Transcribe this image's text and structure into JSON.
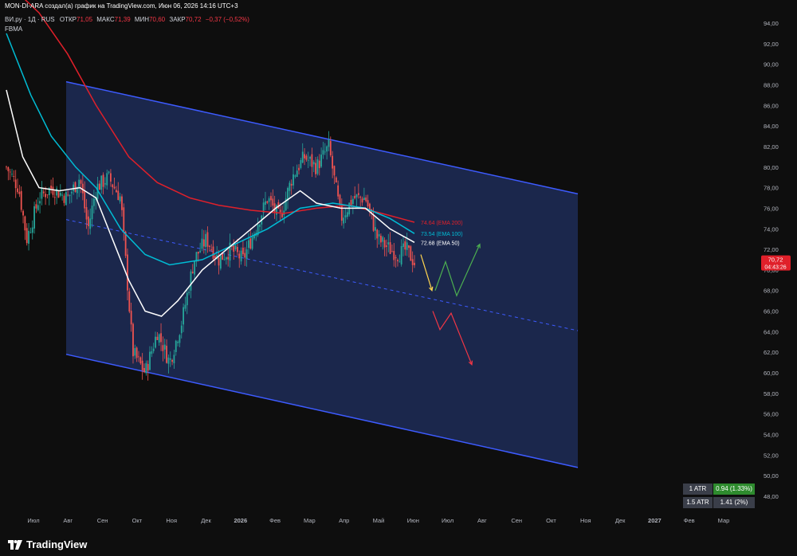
{
  "header": {
    "author_line": "MON-DI-ARA создал(а) график на TradingView.com, Июн 06, 2026 14:16 UTC+3",
    "symbol": "ВИ.ру · 1Д · RUS",
    "open_label": "ОТКР",
    "open_value": "71,05",
    "high_label": "МАКС",
    "high_value": "71,39",
    "low_label": "МИН",
    "low_value": "70,60",
    "close_label": "ЗАКР",
    "close_value": "70,72",
    "change_value": "−0,37 (−0,52%)",
    "indicator_label": "FBMA"
  },
  "price_badge": {
    "price": "70,72",
    "countdown": "04:43:26"
  },
  "atr_table": [
    {
      "label": "1 ATR",
      "value": "0.94 (1.33%)"
    },
    {
      "label": "1.5 ATR",
      "value": "1.41 (2%)"
    }
  ],
  "branding": {
    "logo_text": "TradingView"
  },
  "colors": {
    "background": "#0e0e0e",
    "channel_fill": "#1d2b57",
    "channel_line": "#3d5bff",
    "ema50": "#ffffff",
    "ema100": "#00bcd4",
    "ema200": "#e0202a",
    "up_candle": "#26a69a",
    "down_candle": "#ef5350",
    "arrow_yellow": "#ffd54f",
    "arrow_green": "#4caf50",
    "arrow_red": "#f23645",
    "atr_green": "#2e8b2e"
  },
  "chart_data": {
    "type": "line",
    "title": "",
    "xlabel": "",
    "ylabel": "",
    "y_axis_side": "right",
    "grid": false,
    "ylim": [
      47,
      95
    ],
    "y_ticks": [
      "94,00",
      "92,00",
      "90,00",
      "88,00",
      "86,00",
      "84,00",
      "82,00",
      "80,00",
      "78,00",
      "76,00",
      "74,00",
      "72,00",
      "70,00",
      "68,00",
      "66,00",
      "64,00",
      "62,00",
      "60,00",
      "58,00",
      "56,00",
      "54,00",
      "52,00",
      "50,00",
      "48,00"
    ],
    "x_ticks": [
      "Июл",
      "Авг",
      "Сен",
      "Окт",
      "Ноя",
      "Дек",
      "2026",
      "Фев",
      "Мар",
      "Апр",
      "Май",
      "Июн",
      "Июл",
      "Авг",
      "Сен",
      "Окт",
      "Ноя",
      "Дек",
      "2027",
      "Фев",
      "Мар"
    ],
    "last_price": 70.72,
    "price_path": [
      [
        0,
        80
      ],
      [
        3,
        78
      ],
      [
        5,
        73
      ],
      [
        8,
        77
      ],
      [
        11,
        78
      ],
      [
        15,
        77
      ],
      [
        18,
        79
      ],
      [
        20,
        74
      ],
      [
        22,
        78
      ],
      [
        25,
        79
      ],
      [
        28,
        77
      ],
      [
        31,
        62
      ],
      [
        34,
        60
      ],
      [
        37,
        64
      ],
      [
        40,
        61
      ],
      [
        43,
        65
      ],
      [
        46,
        71
      ],
      [
        49,
        73
      ],
      [
        52,
        71
      ],
      [
        55,
        72
      ],
      [
        58,
        71
      ],
      [
        61,
        74
      ],
      [
        64,
        77
      ],
      [
        67,
        75
      ],
      [
        70,
        79
      ],
      [
        73,
        81
      ],
      [
        76,
        80
      ],
      [
        79,
        82
      ],
      [
        82,
        75
      ],
      [
        85,
        77
      ],
      [
        88,
        77
      ],
      [
        91,
        73
      ],
      [
        94,
        72
      ],
      [
        96,
        71.5
      ],
      [
        98,
        72
      ],
      [
        100,
        70.7
      ]
    ],
    "series": [
      {
        "name": "EMA 200",
        "value": 74.64,
        "label": "74.64 (EMA 200)",
        "points": [
          [
            0,
            98
          ],
          [
            8,
            95
          ],
          [
            15,
            91
          ],
          [
            22,
            86
          ],
          [
            30,
            81
          ],
          [
            37,
            78.5
          ],
          [
            45,
            77
          ],
          [
            52,
            76.3
          ],
          [
            60,
            75.8
          ],
          [
            68,
            75.5
          ],
          [
            76,
            76
          ],
          [
            84,
            76.3
          ],
          [
            92,
            75.5
          ],
          [
            100,
            74.64
          ]
        ]
      },
      {
        "name": "EMA 100",
        "value": 73.54,
        "label": "73.54 (EMA 100)",
        "points": [
          [
            0,
            93
          ],
          [
            6,
            87
          ],
          [
            11,
            83
          ],
          [
            17,
            80
          ],
          [
            22,
            78
          ],
          [
            28,
            74
          ],
          [
            34,
            71.5
          ],
          [
            40,
            70.5
          ],
          [
            48,
            71
          ],
          [
            56,
            72.5
          ],
          [
            64,
            74
          ],
          [
            72,
            76
          ],
          [
            80,
            76.5
          ],
          [
            88,
            76
          ],
          [
            94,
            75
          ],
          [
            100,
            73.54
          ]
        ]
      },
      {
        "name": "EMA 50",
        "value": 72.68,
        "label": "72.68 (EMA 50)",
        "points": [
          [
            0,
            87.5
          ],
          [
            4,
            81
          ],
          [
            8,
            78
          ],
          [
            13,
            77.7
          ],
          [
            18,
            78
          ],
          [
            22,
            77
          ],
          [
            26,
            73
          ],
          [
            30,
            69
          ],
          [
            34,
            66
          ],
          [
            38,
            65.5
          ],
          [
            42,
            67
          ],
          [
            48,
            70
          ],
          [
            54,
            72
          ],
          [
            60,
            74
          ],
          [
            66,
            76
          ],
          [
            72,
            77.7
          ],
          [
            76,
            76.5
          ],
          [
            82,
            76
          ],
          [
            88,
            76
          ],
          [
            94,
            74
          ],
          [
            100,
            72.68
          ]
        ]
      }
    ],
    "annotations": {
      "channel": {
        "upper": {
          "start": 88.3,
          "end": 77.4
        },
        "mid": {
          "start": 74.9,
          "end": 64.1
        },
        "lower": {
          "start": 61.8,
          "end": 50.8
        }
      },
      "arrows": [
        {
          "color": "yellow",
          "from": 71.5,
          "to": 68.0
        },
        {
          "color": "green",
          "points": [
            68.0,
            70.8,
            67.5,
            72.5
          ]
        },
        {
          "color": "red",
          "points": [
            66.0,
            64.2,
            65.8,
            60.8
          ]
        }
      ]
    }
  }
}
